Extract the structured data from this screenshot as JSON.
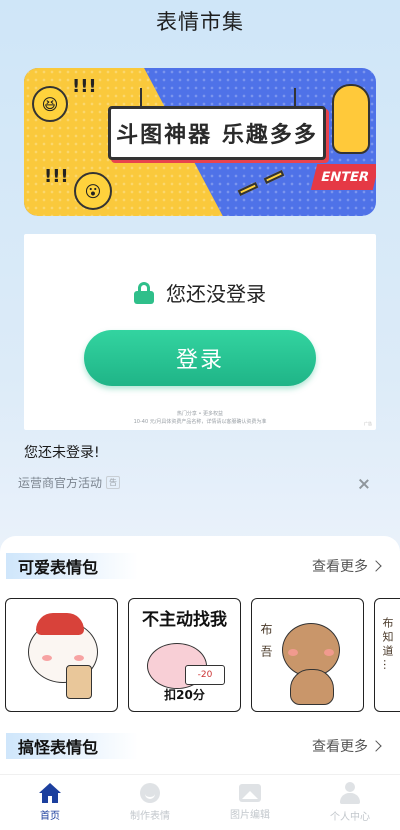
{
  "app": {
    "title": "表情市集"
  },
  "banner": {
    "sign_text": "斗图神器 乐趣多多",
    "enter_text": "ENTER",
    "exclaim_top": "!!!",
    "exclaim_bottom": "!!!"
  },
  "login_card": {
    "prompt": "您还没登录",
    "button_label": "登录",
    "fine_print_line1": "热门分享 • 更多权益",
    "fine_print_line2": "10-40 元/月具体资费产品名称，详情请以客服确认资费为准",
    "fine_print_corner": "广告"
  },
  "status": {
    "not_logged_in": "您还未登录!",
    "operator_link": "运营商官方活动",
    "ad_tag": "告"
  },
  "sections": {
    "cute": {
      "title": "可爱表情包",
      "more": "查看更多"
    },
    "funny": {
      "title": "搞怪表情包",
      "more": "查看更多"
    }
  },
  "stickers": {
    "s2_top": "不主动找我",
    "s2_bottom": "扣20分",
    "s2_paper": "-20",
    "s3_side": "布 吾",
    "s4_side": "布知道…"
  },
  "tabs": [
    {
      "label": "首页",
      "active": true
    },
    {
      "label": "制作表情",
      "active": false
    },
    {
      "label": "图片编辑",
      "active": false
    },
    {
      "label": "个人中心",
      "active": false
    }
  ],
  "colors": {
    "accent_green": "#1fb487",
    "tab_active": "#1c3f9e",
    "tab_inactive": "#c2c7cc"
  }
}
